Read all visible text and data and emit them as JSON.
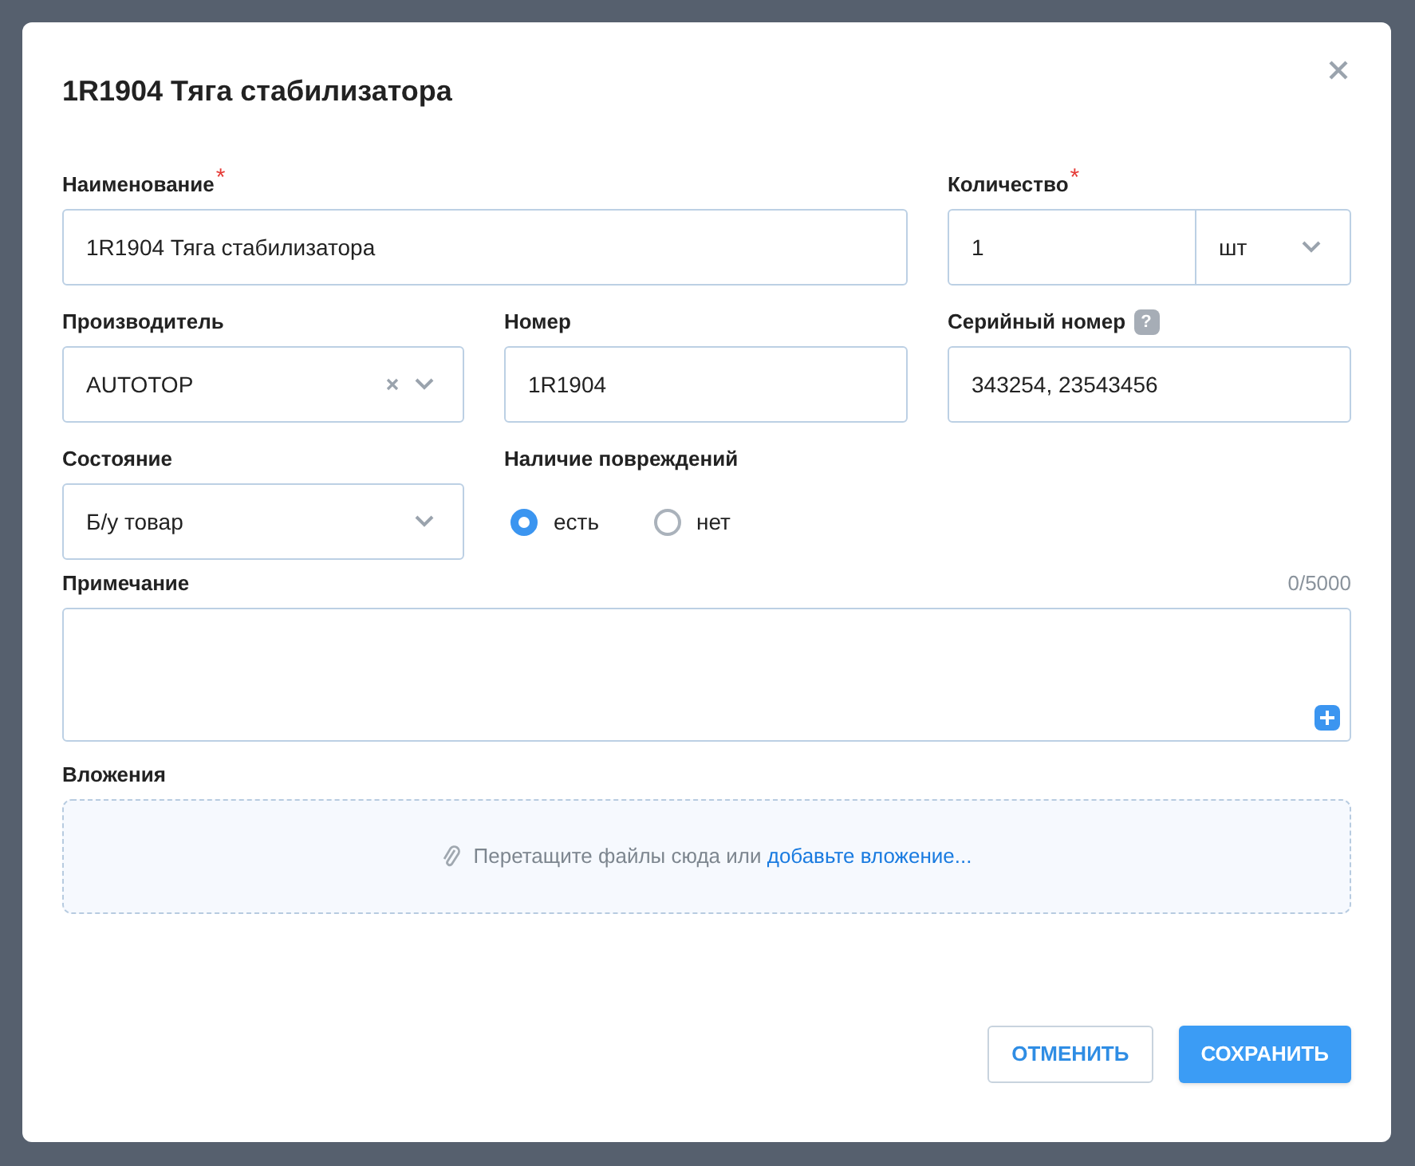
{
  "dialog": {
    "title": "1R1904 Тяга стабилизатора",
    "name": {
      "label": "Наименование",
      "required_mark": "*",
      "value": "1R1904 Тяга стабилизатора"
    },
    "quantity": {
      "label": "Количество",
      "required_mark": "*",
      "value": "1",
      "unit": "шт"
    },
    "manufacturer": {
      "label": "Производитель",
      "value": "AUTOTOP",
      "clearable": true
    },
    "number": {
      "label": "Номер",
      "value": "1R1904"
    },
    "serial": {
      "label": "Серийный номер",
      "help": "?",
      "value": "343254, 23543456"
    },
    "condition": {
      "label": "Состояние",
      "value": "Б/у товар"
    },
    "damage": {
      "label": "Наличие повреждений",
      "options": [
        {
          "label": "есть",
          "selected": true
        },
        {
          "label": "нет",
          "selected": false
        }
      ]
    },
    "note": {
      "label": "Примечание",
      "counter": "0/5000"
    },
    "attachments": {
      "label": "Вложения",
      "hint": "Перетащите файлы сюда или",
      "link": "добавьте вложение..."
    },
    "buttons": [
      {
        "label": "ОТМЕНИТЬ",
        "kind": "secondary"
      },
      {
        "label": "СОХРАНИТЬ",
        "kind": "primary"
      }
    ]
  }
}
